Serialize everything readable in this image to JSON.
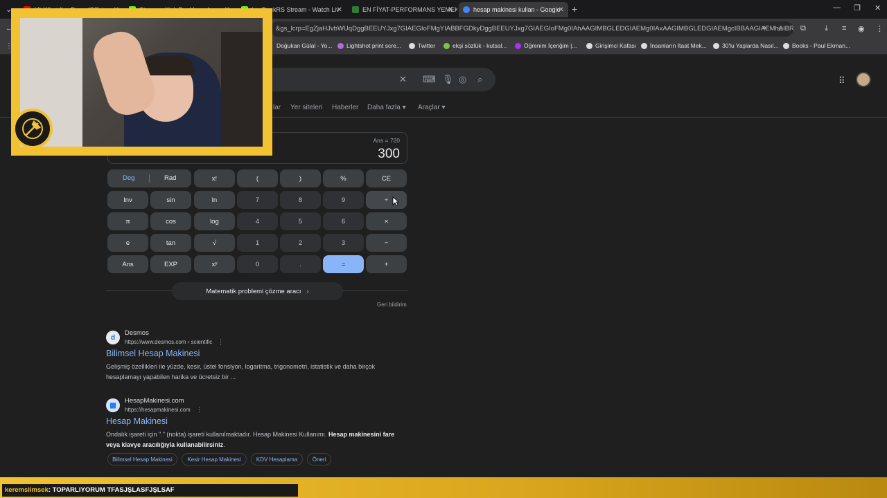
{
  "tabs": [
    {
      "label": "(4) What I've Done (Offici",
      "active": false,
      "color": "#ff0000"
    },
    {
      "label": "Stream - Kick Dashboard",
      "active": false,
      "color": "#53fc18"
    },
    {
      "label": "LegDuckRS Stream - Watch Liv",
      "active": false,
      "color": "#53fc18"
    },
    {
      "label": "EN FİYAT-PERFORMANS YEMEK",
      "active": false,
      "color": "#2e7d32"
    },
    {
      "label": "hesap makinesi kullan - Google",
      "active": true,
      "color": "#4285f4"
    }
  ],
  "address": {
    "url": "&gs_lcrp=EgZjaHJvbWUqDggBEEUYJxg7GIAEGIoFMgYIABBFGDkyDggBEEUYJxg7GIAEGIoFMg0IAhAAGIMBGLEDGIAEMg0IAxAAGIMBGLEDGIAEMgcIBBAAGIAEMhAIBR..."
  },
  "bookmarks": [
    {
      "label": "Doğukan Gülal - Yo..."
    },
    {
      "label": "Lightshot print scre..."
    },
    {
      "label": "Twitter"
    },
    {
      "label": "ekşi sözlük - kutsal..."
    },
    {
      "label": "Öğrenim İçeriğim |..."
    },
    {
      "label": "Girişimci Kafası"
    },
    {
      "label": "İnsanların İtaat Mek..."
    },
    {
      "label": "30'lu Yaşlarda Nasıl..."
    },
    {
      "label": "Books - Paul Ekman..."
    }
  ],
  "nav": {
    "partial": "lar",
    "places": "Yer siteleri",
    "news": "Haberler",
    "more": "Daha fazla",
    "tools": "Araçlar"
  },
  "calculator": {
    "ans_line": "Ans = 720",
    "result": "300",
    "deg": "Deg",
    "rad": "Rad",
    "keys": {
      "fact": "x!",
      "lparen": "(",
      "rparen": ")",
      "pct": "%",
      "ce": "CE",
      "inv": "Inv",
      "sin": "sin",
      "ln": "ln",
      "k7": "7",
      "k8": "8",
      "k9": "9",
      "div": "÷",
      "pi": "π",
      "cos": "cos",
      "log": "log",
      "k4": "4",
      "k5": "5",
      "k6": "6",
      "mul": "×",
      "e": "e",
      "tan": "tan",
      "sqrt": "√",
      "k1": "1",
      "k2": "2",
      "k3": "3",
      "sub": "−",
      "ans": "Ans",
      "exp": "EXP",
      "pow": "xʸ",
      "k0": "0",
      "dot": ".",
      "eq": "=",
      "add": "+"
    },
    "solver": "Matematik problemi çözme aracı",
    "feedback": "Geri bildirim"
  },
  "results": [
    {
      "site": "Desmos",
      "url": "https://www.desmos.com › scientific",
      "title": "Bilimsel Hesap Makinesi",
      "snippet1": "Gelişmiş özellikleri ile yüzde, kesir, üstel fonsiyon, logaritma, trigonometri, istatistik ve daha birçok",
      "snippet2": "hesaplamayı yapabilen harika ve ücretsiz bir ..."
    },
    {
      "site": "HesapMakinesi.com",
      "url": "https://hesapmakinesi.com",
      "title": "Hesap Makinesi",
      "snippet_a": "Ondalık işareti için \".\" (nokta) işareti kullanılmaktadır. Hesap Makinesi Kullanımı. ",
      "snippet_b": "Hesap makinesini fare",
      "snippet_c": "veya klavye aracılığıyla kullanabilirsiniz",
      "snippet_d": "."
    }
  ],
  "chips": [
    "Bilimsel Hesap Makinesi",
    "Kesir Hesap Makinesi",
    "KDV Hesaplama",
    "Öneri"
  ],
  "chat": {
    "user": "keremsiimsek",
    "message": ": TOPARLIYORUM TFASJŞLASFJŞLSAF"
  },
  "colors": {
    "accent": "#8ab4f8",
    "overlay": "#f2c232"
  }
}
